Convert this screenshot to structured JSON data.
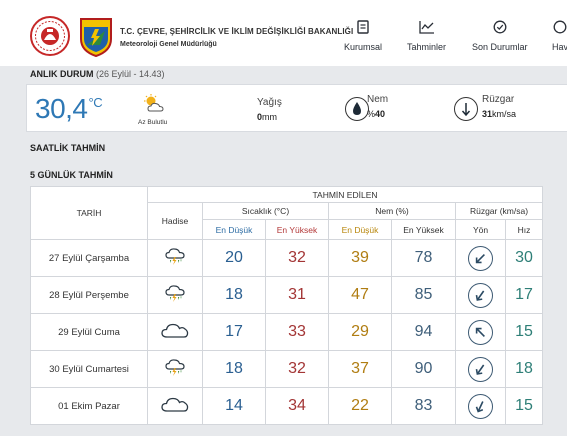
{
  "header": {
    "org_title": "T.C. ÇEVRE, ŞEHİRCİLİK VE İKLİM DEĞİŞİKLİĞİ BAKANLIĞI",
    "org_subtitle": "Meteoroloji Genel Müdürlüğü",
    "logo2_text": "METEOROLOJİ",
    "nav": [
      {
        "label": "Kurumsal",
        "icon": "document-icon"
      },
      {
        "label": "Tahminler",
        "icon": "chart-icon"
      },
      {
        "label": "Son Durumlar",
        "icon": "check-circle-icon"
      },
      {
        "label": "Hav",
        "icon": "globe-icon"
      }
    ]
  },
  "current": {
    "title_prefix": "ANLIK DURUM",
    "timestamp": "(26 Eylül - 14.43)",
    "temperature": "30,4",
    "temp_unit": "°C",
    "condition": "Az Bulutlu",
    "rain_label": "Yağış",
    "rain_value": "0",
    "rain_unit": "mm",
    "humidity_label": "Nem",
    "humidity_prefix": "%",
    "humidity_value": "40",
    "wind_label": "Rüzgar",
    "wind_value": "31",
    "wind_unit": "km/sa"
  },
  "sections": {
    "hourly": "SAATLİK TAHMİN",
    "five_day": "5 GÜNLÜK TAHMİN"
  },
  "table": {
    "group_header": "TAHMİN EDİLEN",
    "col_date": "TARİH",
    "col_event": "Hadise",
    "col_temp": "Sıcaklık (°C)",
    "col_hum": "Nem (%)",
    "col_wind": "Rüzgar (km/sa)",
    "sub_low": "En Düşük",
    "sub_high": "En Yüksek",
    "sub_hum_low": "En Düşük",
    "sub_hum_high": "En Yüksek",
    "sub_dir": "Yön",
    "sub_speed": "Hız",
    "rows": [
      {
        "date": "27 Eylül Çarşamba",
        "icon": "thunderstorm-icon",
        "tmin": "20",
        "tmax": "32",
        "hmin": "39",
        "hmax": "78",
        "wind_dir_deg": 225,
        "speed": "30"
      },
      {
        "date": "28 Eylül Perşembe",
        "icon": "thunderstorm-icon",
        "tmin": "18",
        "tmax": "31",
        "hmin": "47",
        "hmax": "85",
        "wind_dir_deg": 215,
        "speed": "17"
      },
      {
        "date": "29 Eylül Cuma",
        "icon": "cloud-icon",
        "tmin": "17",
        "tmax": "33",
        "hmin": "29",
        "hmax": "94",
        "wind_dir_deg": 315,
        "speed": "15"
      },
      {
        "date": "30 Eylül Cumartesi",
        "icon": "thunderstorm-icon",
        "tmin": "18",
        "tmax": "32",
        "hmin": "37",
        "hmax": "90",
        "wind_dir_deg": 215,
        "speed": "18"
      },
      {
        "date": "01 Ekim Pazar",
        "icon": "cloud-icon",
        "tmin": "14",
        "tmax": "34",
        "hmin": "22",
        "hmax": "83",
        "wind_dir_deg": 205,
        "speed": "15"
      }
    ]
  },
  "colors": {
    "temp_blue": "#2e78b5",
    "low": "#2e6da4",
    "high": "#b33838",
    "humidity_low": "#b8860b"
  }
}
